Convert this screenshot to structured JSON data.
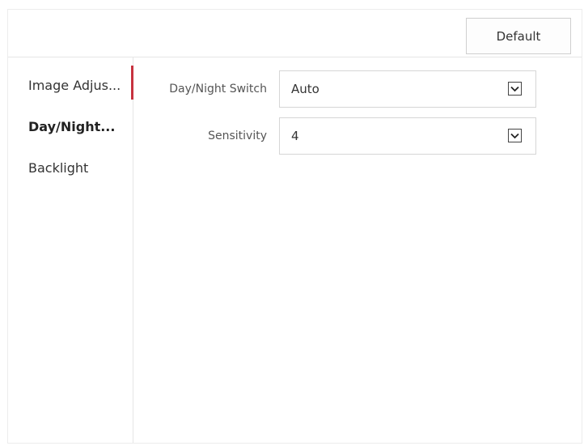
{
  "toolbar": {
    "default_label": "Default"
  },
  "sidebar": {
    "items": [
      {
        "label": "Image Adjus..."
      },
      {
        "label": "Day/Night..."
      },
      {
        "label": "Backlight"
      }
    ],
    "active_index": 1,
    "active_color": "#c7323f"
  },
  "form": {
    "day_night_switch": {
      "label": "Day/Night Switch",
      "value": "Auto"
    },
    "sensitivity": {
      "label": "Sensitivity",
      "value": "4"
    }
  },
  "icons": {
    "dropdown": "chevron-down-icon"
  }
}
